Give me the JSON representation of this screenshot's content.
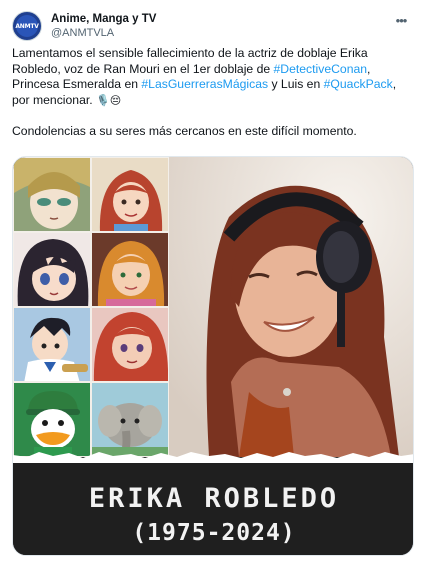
{
  "account": {
    "display_name": "Anime, Manga y TV",
    "handle": "@ANMTVLA",
    "avatar_logo_text": "ANMTV"
  },
  "menu": {
    "more_icon": "more-horizontal-icon"
  },
  "tweet": {
    "line1": "Lamentamos el sensible fallecimiento de la actriz de doblaje Erika",
    "line2a": "Robledo, voz de Ran Mouri en el 1er doblaje de ",
    "hashtag1": "#DetectiveConan",
    "line2b": ",",
    "line3a": "Princesa Esmeralda en ",
    "hashtag2": "#LasGuerrerasMágicas",
    "line3b": " y Luis en ",
    "hashtag3": "#QuackPack",
    "line3c": ",",
    "line4": "por mencionar.",
    "emoji": "🎙️😔",
    "line5": "Condolencias a su seres más cercanos en este difícil momento."
  },
  "media": {
    "banner_name": "ERIKA ROBLEDO",
    "banner_years": "(1975-2024)",
    "thumbnails": [
      "character-thumb-1",
      "character-thumb-2",
      "character-thumb-3",
      "character-thumb-4",
      "character-thumb-5",
      "character-thumb-6",
      "character-thumb-7",
      "character-thumb-8"
    ]
  },
  "colors": {
    "link": "#1d9bf0",
    "text": "#0f1419",
    "muted": "#536471",
    "banner_bg": "#1f1f1f",
    "banner_text": "#f2f2f2"
  }
}
